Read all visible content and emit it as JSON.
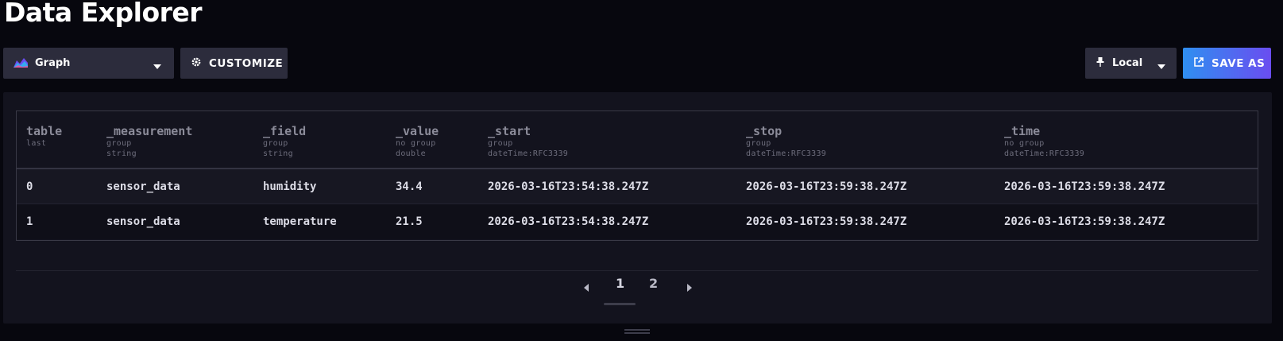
{
  "page": {
    "title": "Data Explorer"
  },
  "toolbar": {
    "graph_label": "Graph",
    "customize_label": "CUSTOMIZE",
    "timezone_label": "Local",
    "save_as_label": "SAVE AS"
  },
  "table": {
    "columns": [
      {
        "name": "table",
        "sub1": "last",
        "sub2": ""
      },
      {
        "name": "_measurement",
        "sub1": "group",
        "sub2": "string"
      },
      {
        "name": "_field",
        "sub1": "group",
        "sub2": "string"
      },
      {
        "name": "_value",
        "sub1": "no group",
        "sub2": "double"
      },
      {
        "name": "_start",
        "sub1": "group",
        "sub2": "dateTime:RFC3339"
      },
      {
        "name": "_stop",
        "sub1": "group",
        "sub2": "dateTime:RFC3339"
      },
      {
        "name": "_time",
        "sub1": "no group",
        "sub2": "dateTime:RFC3339"
      }
    ],
    "rows": [
      [
        "0",
        "sensor_data",
        "humidity",
        "34.4",
        "2026-03-16T23:54:38.247Z",
        "2026-03-16T23:59:38.247Z",
        "2026-03-16T23:59:38.247Z"
      ],
      [
        "1",
        "sensor_data",
        "temperature",
        "21.5",
        "2026-03-16T23:54:38.247Z",
        "2026-03-16T23:59:38.247Z",
        "2026-03-16T23:59:38.247Z"
      ]
    ]
  },
  "pagination": {
    "pages": [
      "1",
      "2"
    ],
    "current": "1"
  },
  "colors": {
    "accent_start": "#2f8ff0",
    "accent_end": "#6a4df0",
    "background": "#07070e",
    "panel": "#13131e"
  }
}
